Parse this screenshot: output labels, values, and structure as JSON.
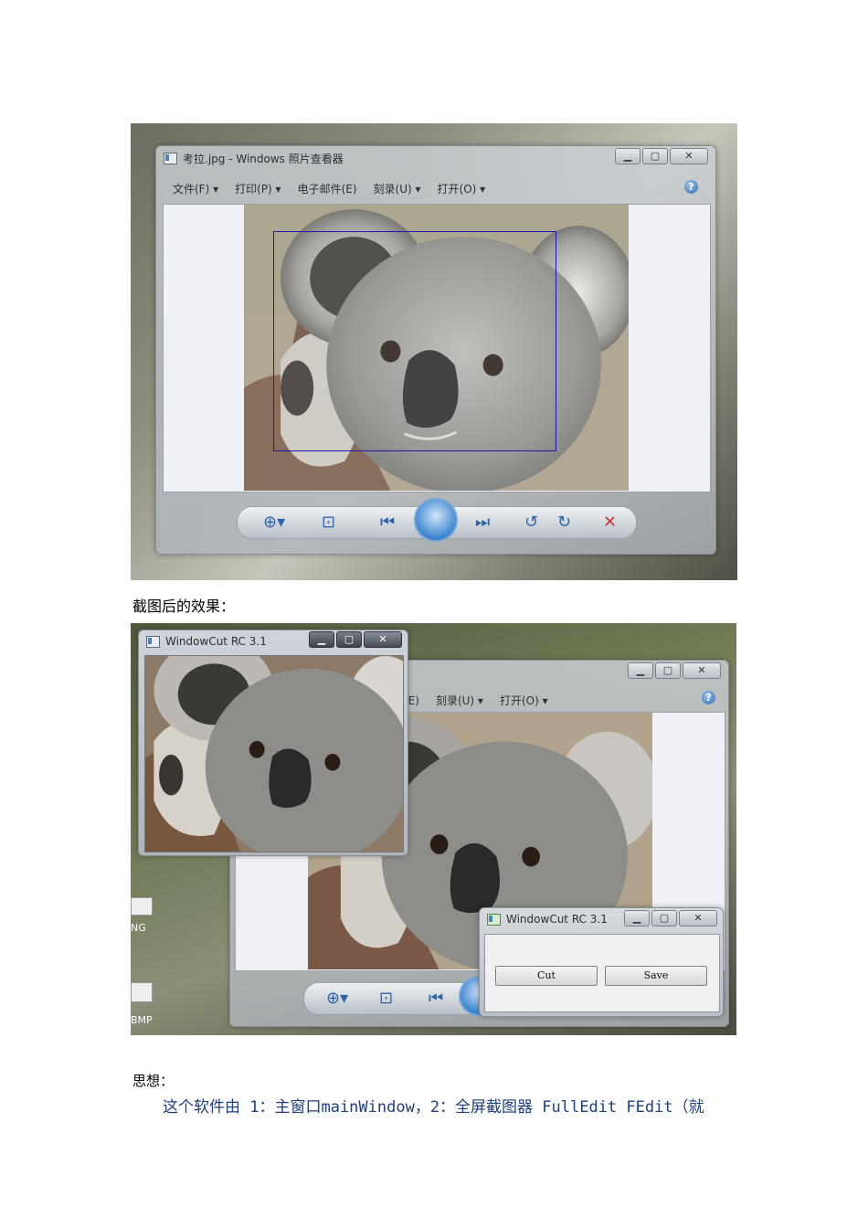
{
  "screenshot_top": {
    "window_title": "考拉.jpg - Windows 照片查看器",
    "menu": [
      "文件(F) ▾",
      "打印(P) ▾",
      "电子邮件(E)",
      "刻录(U) ▾",
      "打开(O) ▾"
    ],
    "help_label": "?",
    "window_buttons": [
      "▁",
      "▢",
      "✕"
    ]
  },
  "caption_after": "截图后的效果：",
  "screenshot_bottom": {
    "cut_window_title": "WindowCut RC 3.1",
    "viewer_menu_partial": [
      "(E)",
      "刻录(U) ▾",
      "打开(O) ▾"
    ],
    "help_label": "?",
    "control_window_title": "WindowCut RC 3.1",
    "cut_button": "Cut",
    "save_button": "Save",
    "desktop_labels": [
      "NG",
      "BMP"
    ],
    "window_buttons": [
      "▁",
      "▢",
      "✕"
    ]
  },
  "section_heading": "思想：",
  "body_line": "这个软件由 1：主窗口mainWindow，2：全屏截图器 FullEdit FEdit（就",
  "colors": {
    "selection": "#1a1aa8",
    "body_text": "#1f3d7a",
    "window_frame": "#aab0b7"
  }
}
